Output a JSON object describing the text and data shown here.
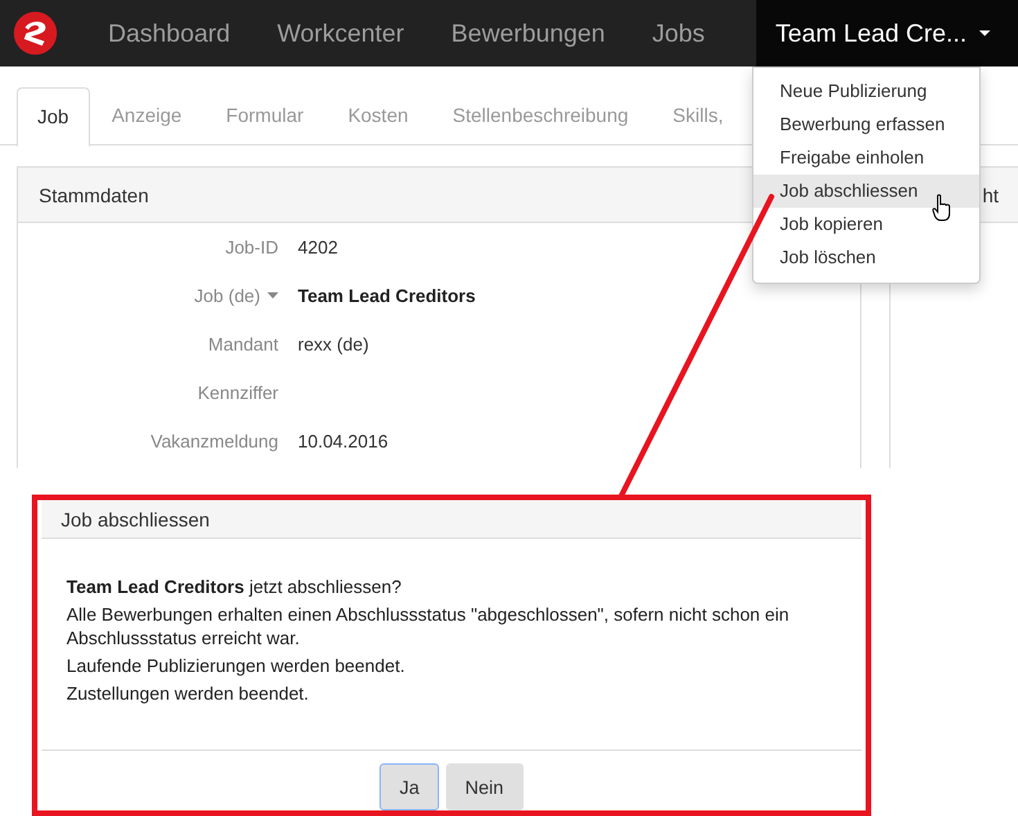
{
  "navbar": {
    "items": [
      {
        "label": "Dashboard",
        "selected": false,
        "dropdown": false
      },
      {
        "label": "Workcenter",
        "selected": false,
        "dropdown": false
      },
      {
        "label": "Bewerbungen",
        "selected": false,
        "dropdown": false
      },
      {
        "label": "Jobs",
        "selected": false,
        "dropdown": false
      },
      {
        "label": "Team Lead Cre...",
        "selected": true,
        "dropdown": true
      }
    ]
  },
  "tabs": [
    {
      "label": "Job",
      "selected": true
    },
    {
      "label": "Anzeige",
      "selected": false
    },
    {
      "label": "Formular",
      "selected": false
    },
    {
      "label": "Kosten",
      "selected": false
    },
    {
      "label": "Stellenbeschreibung",
      "selected": false
    },
    {
      "label": "Skills,",
      "selected": false
    }
  ],
  "panel": {
    "title": "Stammdaten",
    "fields": [
      {
        "label": "Job-ID",
        "value": "4202",
        "kind": "text"
      },
      {
        "label": "Job (de)",
        "value": "Team Lead Creditors",
        "kind": "select"
      },
      {
        "label": "Mandant",
        "value": "rexx (de)",
        "kind": "text"
      },
      {
        "label": "Kennziffer",
        "kind": "text"
      },
      {
        "label": "Vakanzmeldung",
        "value": "10.04.2016",
        "kind": "text"
      }
    ]
  },
  "side_panel": {
    "title": "ht"
  },
  "dropdown_menu": {
    "items": [
      {
        "label": "Neue Publizierung",
        "selected": false
      },
      {
        "label": "Bewerbung erfassen",
        "selected": false
      },
      {
        "label": "Freigabe einholen",
        "selected": false
      },
      {
        "label": "Job abschliessen",
        "selected": true
      },
      {
        "label": "Job kopieren",
        "selected": false
      },
      {
        "label": "Job löschen",
        "selected": false
      }
    ]
  },
  "dialog": {
    "title": "Job abschliessen",
    "lines": [
      "**Team Lead Creditors** jetzt abschliessen?",
      "Alle Bewerbungen erhalten einen Abschlussstatus \"abgeschlossen\", sofern nicht schon ein Abschlussstatus erreicht war.",
      "Laufende Publizierungen werden beendet.",
      "Zustellungen werden beendet."
    ],
    "buttons": [
      {
        "label": "Ja",
        "selected": true
      },
      {
        "label": "Nein",
        "selected": false
      }
    ]
  }
}
